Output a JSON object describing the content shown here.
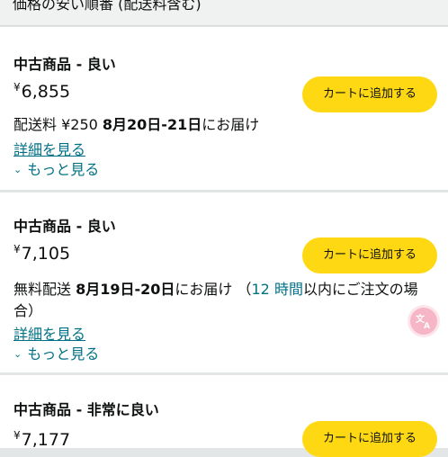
{
  "sort_header": {
    "label": "価格の安い順番 (配送料含む)"
  },
  "offers": [
    {
      "condition": "中古商品 - 良い",
      "currency": "¥",
      "price": "6,855",
      "cart_button": "カートに追加する",
      "delivery": {
        "prefix": "配送料 ¥250 ",
        "date": "8月20日-21日",
        "suffix": "にお届け"
      },
      "details_link": "詳細を見る",
      "more_label": "もっと見る"
    },
    {
      "condition": "中古商品 - 良い",
      "currency": "¥",
      "price": "7,105",
      "cart_button": "カートに追加する",
      "delivery": {
        "prefix": "無料配送 ",
        "date": "8月19日-20日",
        "suffix": "にお届け （",
        "hours": "12 時間",
        "tail": "以内にご注文の場合）"
      },
      "details_link": "詳細を見る",
      "more_label": "もっと見る"
    },
    {
      "condition": "中古商品 - 非常に良い",
      "currency": "¥",
      "price": "7,177",
      "cart_button": "カートに追加する"
    }
  ],
  "icons": {
    "translate": "translate-icon",
    "expand": "chevron-down-icon"
  },
  "colors": {
    "button": "#ffd814",
    "link": "#007185",
    "divider": "#e3e6e6",
    "translate_fab": "#f6b6c8"
  }
}
